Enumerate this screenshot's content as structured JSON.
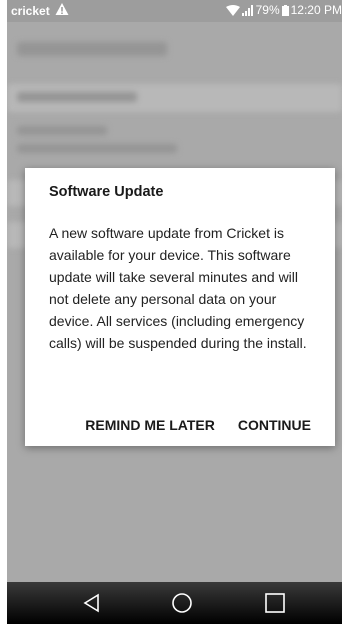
{
  "status_bar": {
    "carrier": "cricket",
    "battery": "79%",
    "time": "12:20 PM",
    "icons": [
      "alert-icon",
      "wifi-icon",
      "signal-icon",
      "battery-icon"
    ]
  },
  "dialog": {
    "title": "Software Update",
    "body": "A new software update from Cricket is available for your device. This software update will take several minutes and will not delete any personal data on your device. All services (including emergency calls) will be suspended during the install.",
    "remind_label": "REMIND ME LATER",
    "continue_label": "CONTINUE"
  },
  "nav_bar": {
    "icons": [
      "back-icon",
      "home-icon",
      "recents-icon"
    ]
  },
  "colors": {
    "scrim": "#a9a9a9",
    "dialog_bg": "#ffffff",
    "text": "#1a1a1a",
    "nav_bg": "#000000"
  }
}
